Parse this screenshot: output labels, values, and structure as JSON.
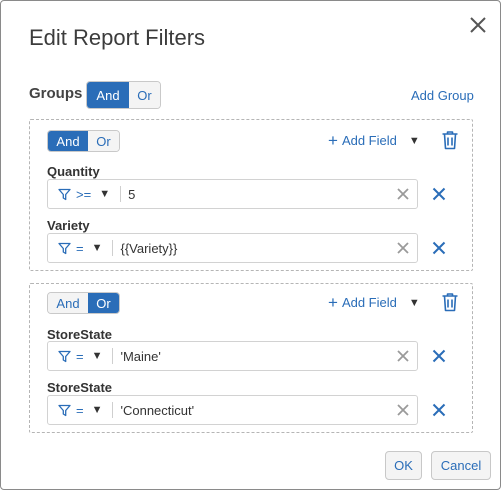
{
  "dialog": {
    "title": "Edit Report Filters",
    "close_icon": "close-icon"
  },
  "groups": {
    "label": "Groups",
    "and_label": "And",
    "or_label": "Or",
    "selected": "And",
    "add_group_label": "Add Group"
  },
  "filter_groups": [
    {
      "and_label": "And",
      "or_label": "Or",
      "selected": "And",
      "add_field_label": "Add Field",
      "fields": [
        {
          "label": "Quantity",
          "operator": ">=",
          "value": "5"
        },
        {
          "label": "Variety",
          "operator": "=",
          "value": "{{Variety}}"
        }
      ]
    },
    {
      "and_label": "And",
      "or_label": "Or",
      "selected": "Or",
      "add_field_label": "Add Field",
      "fields": [
        {
          "label": "StoreState",
          "operator": "=",
          "value": "'Maine'"
        },
        {
          "label": "StoreState",
          "operator": "=",
          "value": "'Connecticut'"
        }
      ]
    }
  ],
  "footer": {
    "ok_label": "OK",
    "cancel_label": "Cancel"
  },
  "colors": {
    "accent": "#2a6db8",
    "border": "#b5b5b5"
  }
}
